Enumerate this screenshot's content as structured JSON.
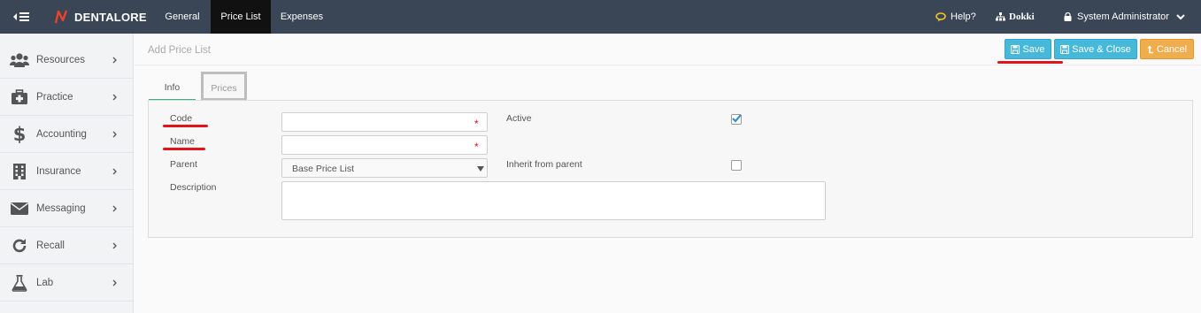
{
  "header": {
    "brand": "DENTALORE",
    "nav_tabs": [
      {
        "label": "General"
      },
      {
        "label": "Price List"
      },
      {
        "label": "Expenses"
      }
    ],
    "help_label": "Help?",
    "org_label": "Dokki",
    "user_label": "System Administrator"
  },
  "sidebar": {
    "items": [
      {
        "label": "Resources",
        "icon": "users-icon"
      },
      {
        "label": "Practice",
        "icon": "medkit-icon"
      },
      {
        "label": "Accounting",
        "icon": "dollar-icon"
      },
      {
        "label": "Insurance",
        "icon": "building-icon"
      },
      {
        "label": "Messaging",
        "icon": "envelope-icon"
      },
      {
        "label": "Recall",
        "icon": "refresh-icon"
      },
      {
        "label": "Lab",
        "icon": "flask-icon"
      }
    ]
  },
  "page": {
    "title": "Add Price List",
    "actions": {
      "save": "Save",
      "save_close": "Save & Close",
      "cancel": "Cancel"
    },
    "tabs": [
      {
        "label": "Info"
      },
      {
        "label": "Prices"
      }
    ]
  },
  "form": {
    "code": {
      "label": "Code",
      "value": "",
      "required_marker": "*"
    },
    "name": {
      "label": "Name",
      "value": "",
      "required_marker": "*"
    },
    "parent": {
      "label": "Parent",
      "selected": "Base Price List"
    },
    "description": {
      "label": "Description",
      "value": ""
    },
    "active": {
      "label": "Active",
      "checked": true
    },
    "inherit": {
      "label": "Inherit from parent",
      "checked": false
    }
  },
  "colors": {
    "topbar": "#3a4555",
    "accent_info": "#46b8da",
    "accent_warning": "#f0ad4e",
    "annotation_red": "#e0151b",
    "tab_active": "#3bb083"
  }
}
